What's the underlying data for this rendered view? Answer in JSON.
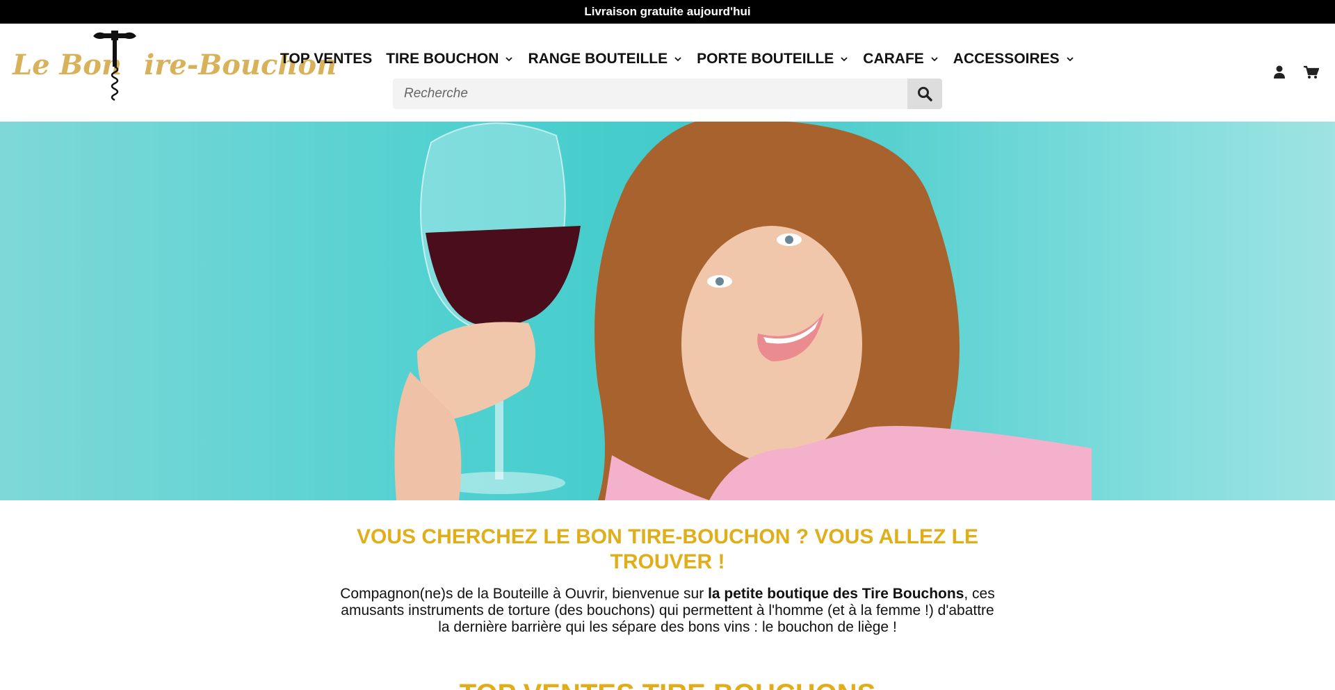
{
  "announcement": "Livraison gratuite aujourd'hui",
  "brand": {
    "logo_text_1": "Le Bon",
    "logo_text_2": "ire-Bouchon",
    "logo_color": "#d8b25a"
  },
  "nav": {
    "items": [
      {
        "label": "TOP VENTES",
        "has_dropdown": false
      },
      {
        "label": "TIRE BOUCHON",
        "has_dropdown": true
      },
      {
        "label": "RANGE BOUTEILLE",
        "has_dropdown": true
      },
      {
        "label": "PORTE BOUTEILLE",
        "has_dropdown": true
      },
      {
        "label": "CARAFE",
        "has_dropdown": true
      },
      {
        "label": "ACCESSOIRES",
        "has_dropdown": true
      }
    ]
  },
  "search": {
    "placeholder": "Recherche",
    "icon": "search-icon"
  },
  "header_icons": [
    "user-icon",
    "cart-icon"
  ],
  "hero": {
    "image": "woman-holding-red-wine-glass",
    "background_color": "#4fd0d0"
  },
  "intro": {
    "title": "VOUS CHERCHEZ LE BON TIRE-BOUCHON ?     VOUS ALLEZ LE TROUVER !",
    "text_before": "Compagnon(ne)s de la Bouteille à Ouvrir, bienvenue sur ",
    "text_bold": "la petite boutique des Tire Bouchons",
    "text_after": ", ces amusants instruments de torture (des bouchons) qui permettent à l'homme (et à la femme !) d'abattre la dernière barrière qui les sépare des bons vins     : le bouchon de liège !"
  },
  "section_title": "TOP VENTES TIRE BOUCHONS",
  "accent_color": "#e0ae18"
}
